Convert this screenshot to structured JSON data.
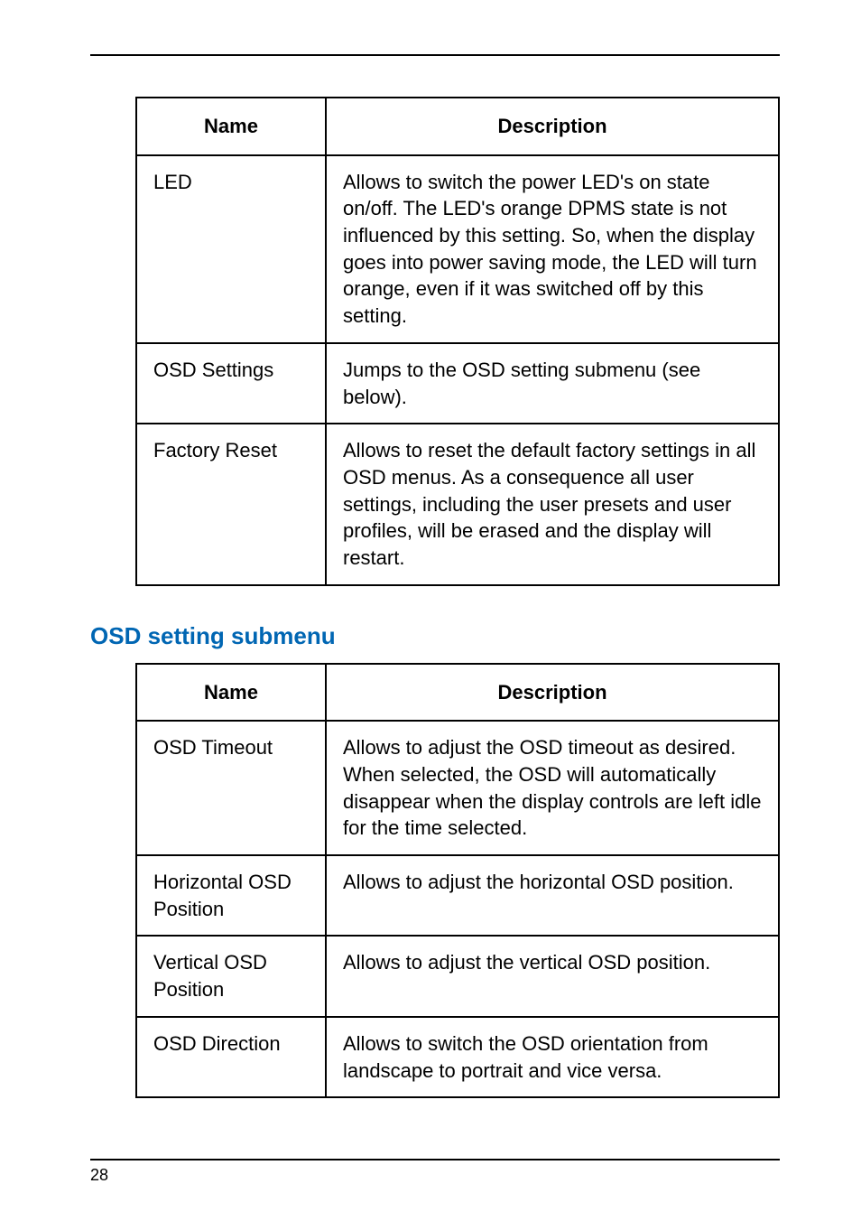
{
  "table1": {
    "headers": {
      "name": "Name",
      "description": "Description"
    },
    "rows": [
      {
        "name": "LED",
        "description": "Allows to switch the power LED's on state on/off. The LED's orange DPMS state is not influenced by this setting. So, when the display goes into power saving mode, the LED will turn orange, even if it was switched off by this setting."
      },
      {
        "name": "OSD Settings",
        "description": "Jumps to the OSD setting submenu (see below)."
      },
      {
        "name": "Factory Reset",
        "description": "Allows to reset the default factory settings in all OSD menus. As a consequence all user settings, including the user presets and user profiles, will be erased and the display will restart."
      }
    ]
  },
  "section_heading": "OSD setting submenu",
  "table2": {
    "headers": {
      "name": "Name",
      "description": "Description"
    },
    "rows": [
      {
        "name": "OSD Timeout",
        "description": "Allows to adjust the OSD timeout as desired. When selected, the OSD will automatically disappear when the display controls are left idle for the time selected."
      },
      {
        "name": "Horizontal OSD Position",
        "description": "Allows to adjust the horizontal OSD position."
      },
      {
        "name": "Vertical OSD Position",
        "description": "Allows to adjust the vertical OSD position."
      },
      {
        "name": "OSD Direction",
        "description": "Allows to switch the OSD orientation from landscape to portrait and vice versa."
      }
    ]
  },
  "page_number": "28"
}
